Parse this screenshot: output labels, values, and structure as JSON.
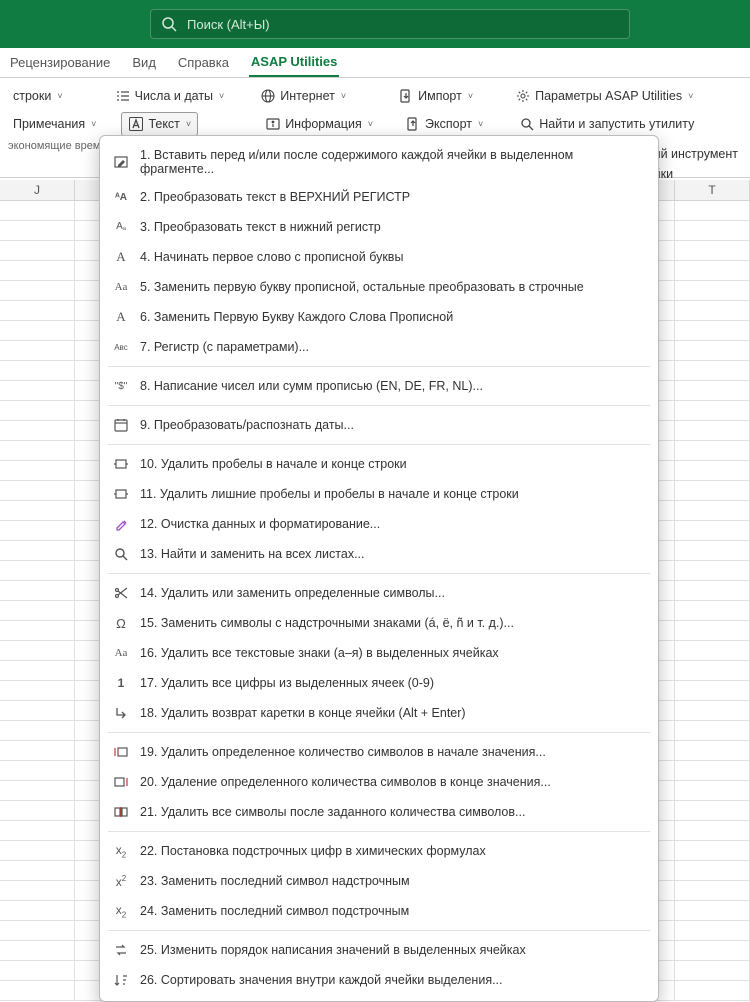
{
  "search": {
    "placeholder": "Поиск (Alt+Ы)"
  },
  "tabs": {
    "review": "Рецензирование",
    "view": "Вид",
    "help": "Справка",
    "asap": "ASAP Utilities"
  },
  "ribbon": {
    "rows_label": "строки",
    "notes_label": "Примечания",
    "numbers_dates": "Числа и даты",
    "text": "Текст",
    "internet": "Интернет",
    "information": "Информация",
    "import": "Импорт",
    "export": "Экспорт",
    "asap_params": "Параметры ASAP Utilities",
    "find_run": "Найти и запустить утилиту",
    "category_text": "экономящие время ",
    "tail_text_1": "ний инструмент",
    "tail_text_2": "ойки"
  },
  "menu": {
    "items": [
      "1. Вставить перед и/или после содержимого каждой ячейки в выделенном фрагменте...",
      "2. Преобразовать текст в ВЕРХНИЙ РЕГИСТР",
      "3. Преобразовать текст в нижний регистр",
      "4. Начинать первое слово с прописной буквы",
      "5. Заменить первую букву прописной, остальные преобразовать в строчные",
      "6. Заменить Первую Букву Каждого Слова Прописной",
      "7. Регистр (с параметрами)...",
      "8. Написание чисел или сумм прописью (EN, DE, FR, NL)...",
      "9. Преобразовать/распознать даты...",
      "10. Удалить пробелы в начале и конце строки",
      "11. Удалить лишние пробелы и пробелы в начале и конце строки",
      "12. Очистка данных и форматирование...",
      "13. Найти и заменить на всех листах...",
      "14. Удалить или заменить определенные символы...",
      "15. Заменить символы с надстрочными знаками (á, ë, ñ и т. д.)...",
      "16. Удалить все текстовые знаки (а–я) в выделенных ячейках",
      "17. Удалить все цифры из выделенных ячеек (0-9)",
      "18. Удалить возврат каретки в конце ячейки (Alt + Enter)",
      "19. Удалить определенное количество символов в начале значения...",
      "20. Удаление определенного количества символов в конце значения...",
      "21. Удалить все символы после заданного количества символов...",
      "22. Постановка подстрочных цифр в химических формулах",
      "23. Заменить последний символ надстрочным",
      "24. Заменить последний символ подстрочным",
      "25. Изменить порядок написания значений в выделенных ячейках",
      "26. Сортировать значения внутри каждой ячейки выделения..."
    ]
  },
  "columns": [
    "J",
    "",
    "",
    "",
    "",
    "",
    "",
    "",
    "",
    "T"
  ],
  "menu_icons": [
    "edit-icon",
    "upper-icon",
    "lower-icon",
    "letter-a-icon",
    "dual-a-icon",
    "letter-a-icon",
    "abc-icon",
    "dollar-quote-icon",
    "calendar-icon",
    "trim-icon",
    "trim-icon",
    "brush-icon",
    "search-icon",
    "scissors-icon",
    "omega-icon",
    "dual-a-icon",
    "one-icon",
    "enter-arrow-icon",
    "trim-left-icon",
    "trim-right-icon",
    "trim-middle-icon",
    "subscript-x-icon",
    "superscript-x-icon",
    "subscript-x-icon",
    "reverse-icon",
    "sort-icon"
  ]
}
